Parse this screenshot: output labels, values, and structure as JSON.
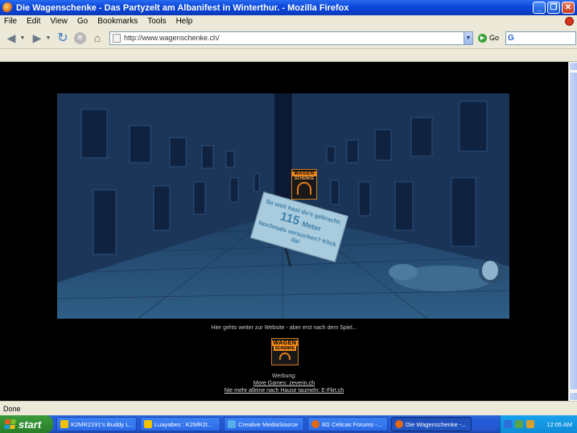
{
  "window": {
    "title": "Die Wagenschenke - Das Partyzelt am Albanifest in Winterthur. - Mozilla Firefox",
    "controls": [
      "_",
      "❐",
      "✕"
    ]
  },
  "menu": [
    "File",
    "Edit",
    "View",
    "Go",
    "Bookmarks",
    "Tools",
    "Help"
  ],
  "navigation": {
    "url": "http://www.wagenschenke.ch/",
    "go_label": "Go",
    "search_placeholder": ""
  },
  "game": {
    "logo_line1": "WAGEN",
    "logo_line2": "SCHENKE",
    "sign_line1": "So weit hast du's gebracht:",
    "distance": "115",
    "unit": "Meter",
    "sign_line3": "Nochmals versuchen? Klick da!"
  },
  "page": {
    "intro_text": "Hier gehts weiter zur Website - aber erst nach dem Spiel...",
    "logo_line1": "WAGEN",
    "logo_line2": "SCHENKE",
    "ad_label": "Werbung:",
    "link1": "More Games: zeverin.ch",
    "link2": "Nie mehr alleine nach Hause taumeln: E-Flirt.ch"
  },
  "status": "Done",
  "taskbar": {
    "start_label": "start",
    "items": [
      {
        "label": "K2MR2191's Buddy L...",
        "color": "#f2c200"
      },
      {
        "label": "Luayabes : K2MR2t...",
        "color": "#f2c200"
      },
      {
        "label": "Creative MediaSource",
        "color": "#59b0e8"
      },
      {
        "label": "6G Celicas Forums -...",
        "color": "#e06a14"
      },
      {
        "label": "Die Wagenschenke -...",
        "color": "#e06a14"
      }
    ],
    "clock": "12:05 AM"
  }
}
